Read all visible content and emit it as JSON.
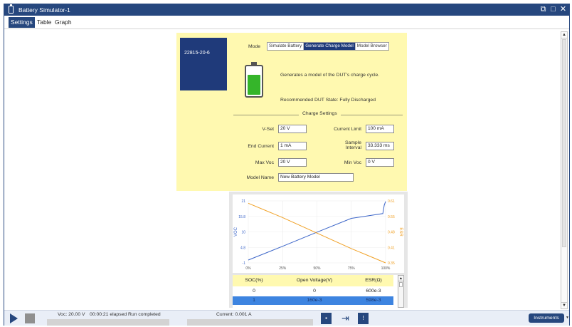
{
  "window": {
    "title": "Battery Simulator-1"
  },
  "tabs": [
    "Settings",
    "Table",
    "Graph"
  ],
  "colors": {
    "title_bar": "#26477e",
    "panel_yellow": "#fff9b0",
    "voc_line": "#3a64c8",
    "esr_line": "#f0a024",
    "battery_green": "#35b52a",
    "selected_row": "#3d84e0"
  },
  "settings": {
    "model_card": "22815-20-6",
    "mode_label": "Mode",
    "mode_options": [
      "Simulate Battery",
      "Generate Charge Model",
      "Model Browser"
    ],
    "mode_selected": "Generate Charge Model",
    "description": "Generates a model of the DUT's charge cycle.",
    "recommended": "Recommended DUT State: Fully Discharged",
    "section_title": "Charge Settings",
    "fields": {
      "vset": {
        "label": "V-Set",
        "value": "20 V"
      },
      "current_limit": {
        "label": "Current Limit",
        "value": "100 mA"
      },
      "end_current": {
        "label": "End Current",
        "value": "1 mA"
      },
      "sample_interval": {
        "label": "Sample Interval",
        "value": "33.333 ms"
      },
      "max_voc": {
        "label": "Max Voc",
        "value": "20 V"
      },
      "min_voc": {
        "label": "Min Voc",
        "value": "0 V"
      },
      "model_name": {
        "label": "Model Name",
        "value": "New Battery Model"
      }
    }
  },
  "chart_data": {
    "type": "line",
    "xlabel": "",
    "ylabel": "VOC",
    "y2label": "ESR",
    "x_ticks": [
      "0%",
      "25%",
      "50%",
      "75%",
      "100%"
    ],
    "y_ticks": [
      "21",
      "15.8",
      "10",
      "4.8",
      "-1"
    ],
    "y2_ticks": [
      "0.61",
      "0.55",
      "0.48",
      "0.41",
      "0.35"
    ],
    "xlim": [
      0,
      100
    ],
    "ylim": [
      -1,
      21
    ],
    "y2lim": [
      0.35,
      0.61
    ],
    "series": [
      {
        "name": "VOC",
        "axis": "left",
        "color": "#3a64c8",
        "x": [
          0,
          25,
          50,
          75,
          98,
          99,
          100
        ],
        "y": [
          0,
          4.9,
          9.9,
          14.8,
          16.5,
          19.5,
          20.8
        ]
      },
      {
        "name": "ESR",
        "axis": "right",
        "color": "#f0a024",
        "x": [
          0,
          25,
          50,
          75,
          100
        ],
        "y": [
          0.6,
          0.54,
          0.475,
          0.41,
          0.35
        ]
      }
    ],
    "grid": true,
    "legend": "none"
  },
  "table": {
    "headers": [
      "SOC(%)",
      "Open Voltage(V)",
      "ESR(Ω)"
    ],
    "rows": [
      [
        "0",
        "0",
        "600e-3"
      ],
      [
        "1",
        "160e-3",
        "598e-3"
      ]
    ]
  },
  "status": {
    "voc": "Voc: 20.00 V",
    "elapsed": "00:00:21  elapsed",
    "run_state": "Run completed",
    "current": "Current: 0.001 A",
    "instruments": "Instruments"
  },
  "icons": [
    "battery-icon",
    "play-icon",
    "stop-icon",
    "save-icon",
    "export-icon",
    "clipboard-icon",
    "restore-icon",
    "maximize-icon",
    "close-icon"
  ]
}
